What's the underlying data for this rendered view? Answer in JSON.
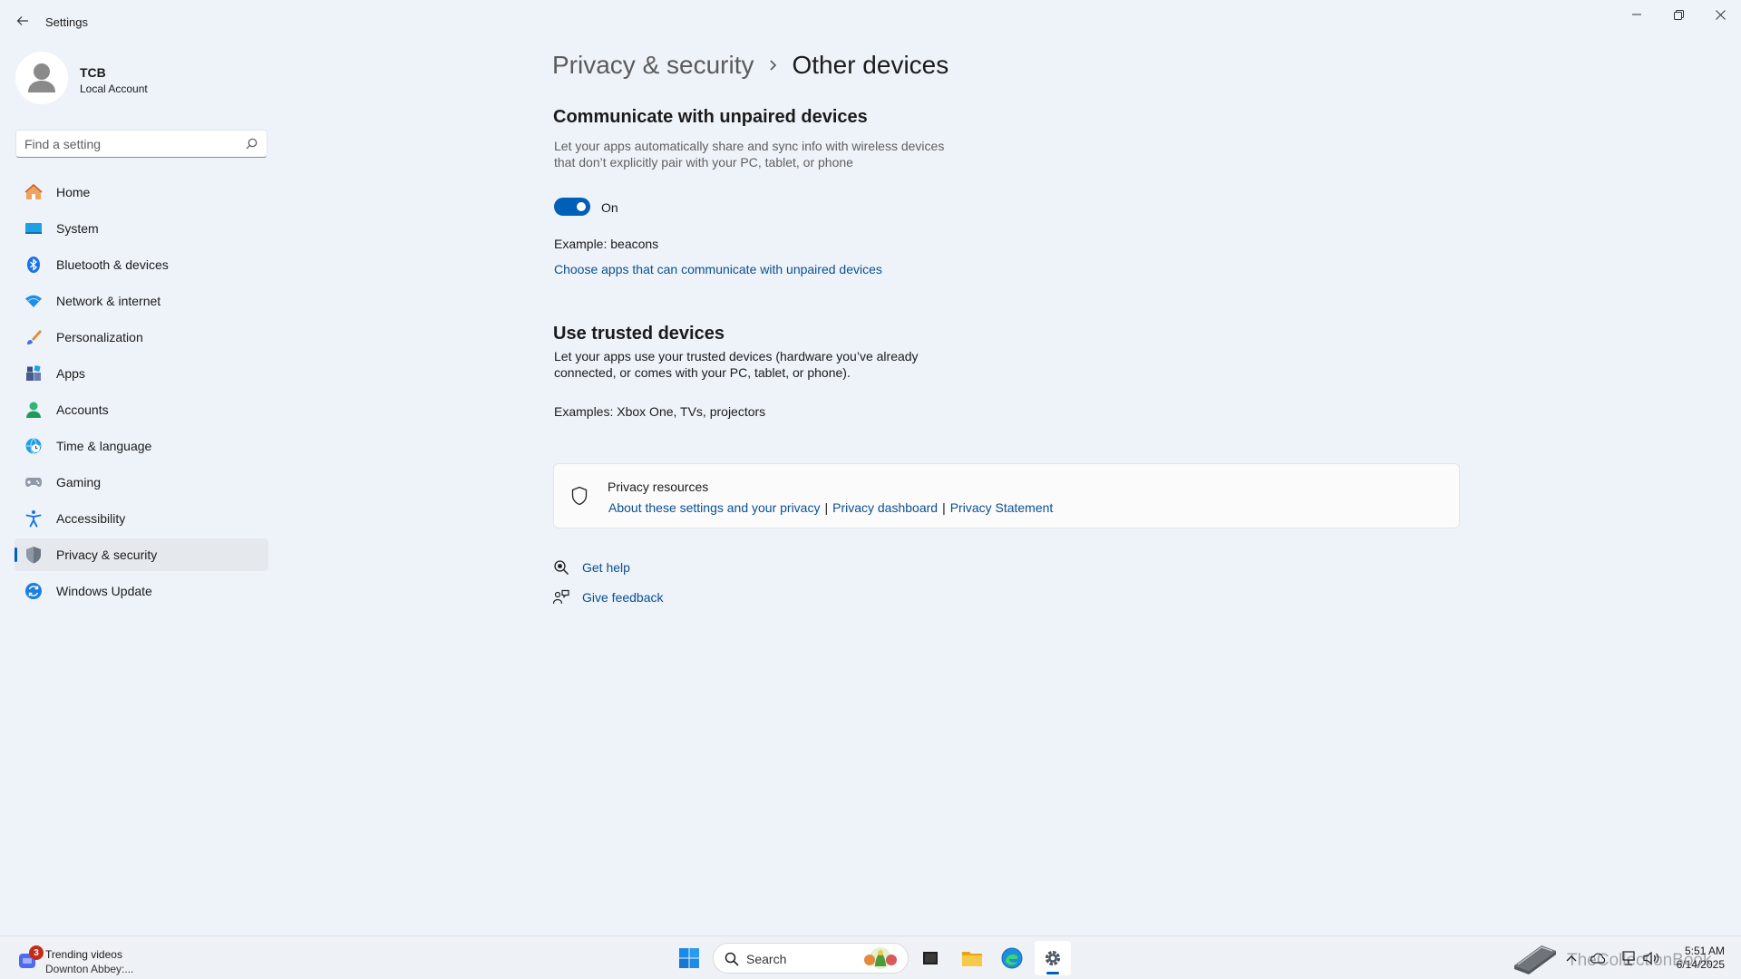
{
  "app": {
    "title": "Settings"
  },
  "user": {
    "name": "TCB",
    "account_type": "Local Account"
  },
  "search": {
    "placeholder": "Find a setting"
  },
  "sidebar": {
    "items": [
      {
        "label": "Home",
        "icon": "home-icon"
      },
      {
        "label": "System",
        "icon": "monitor-icon"
      },
      {
        "label": "Bluetooth & devices",
        "icon": "bluetooth-icon"
      },
      {
        "label": "Network & internet",
        "icon": "wifi-icon"
      },
      {
        "label": "Personalization",
        "icon": "brush-icon"
      },
      {
        "label": "Apps",
        "icon": "apps-icon"
      },
      {
        "label": "Accounts",
        "icon": "person-icon"
      },
      {
        "label": "Time & language",
        "icon": "globe-clock-icon"
      },
      {
        "label": "Gaming",
        "icon": "gamepad-icon"
      },
      {
        "label": "Accessibility",
        "icon": "accessibility-icon"
      },
      {
        "label": "Privacy & security",
        "icon": "shield-icon",
        "active": true
      },
      {
        "label": "Windows Update",
        "icon": "update-icon"
      }
    ]
  },
  "breadcrumb": {
    "parent": "Privacy & security",
    "current": "Other devices"
  },
  "unpaired": {
    "heading": "Communicate with unpaired devices",
    "description": "Let your apps automatically share and sync info with wireless devices that don’t explicitly pair with your PC, tablet, or phone",
    "toggle_state": "On",
    "toggle_on": true,
    "example": "Example: beacons",
    "link": "Choose apps that can communicate with unpaired devices"
  },
  "trusted": {
    "heading": "Use trusted devices",
    "description": "Let your apps use your trusted devices (hardware you’ve already connected, or comes with your PC, tablet, or phone).",
    "example": "Examples: Xbox One, TVs, projectors"
  },
  "privacy_resources": {
    "title": "Privacy resources",
    "links": [
      "About these settings and your privacy",
      "Privacy dashboard",
      "Privacy Statement"
    ],
    "separator": "|"
  },
  "help": {
    "get_help": "Get help",
    "give_feedback": "Give feedback"
  },
  "taskbar": {
    "widget": {
      "badge": "3",
      "title": "Trending videos",
      "subtitle": "Downton Abbey:..."
    },
    "search_label": "Search",
    "watermark": "TheCollectionBook",
    "time": "5:51 AM",
    "date": "6/14/2025"
  },
  "colors": {
    "accent": "#005fb8",
    "link": "#0a4f92",
    "background": "#eef3f9"
  }
}
